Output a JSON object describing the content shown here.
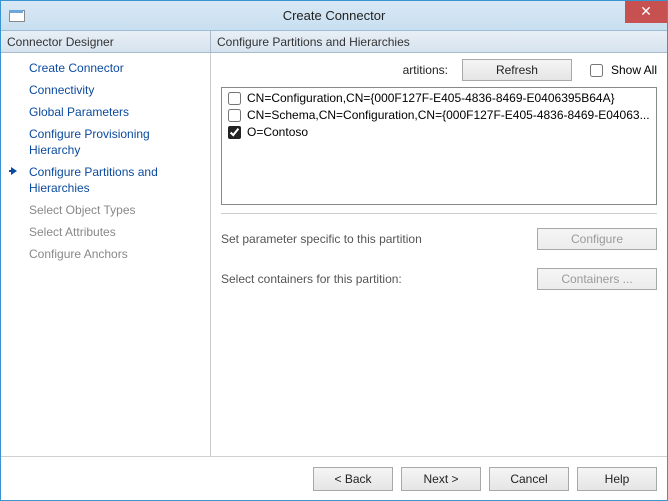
{
  "window": {
    "title": "Create Connector"
  },
  "header": {
    "left_label": "Connector Designer",
    "right_label": "Configure Partitions and Hierarchies"
  },
  "sidebar": {
    "items": [
      {
        "label": "Create Connector",
        "disabled": false
      },
      {
        "label": "Connectivity",
        "disabled": false
      },
      {
        "label": "Global Parameters",
        "disabled": false
      },
      {
        "label": "Configure Provisioning Hierarchy",
        "disabled": false
      },
      {
        "label": "Configure Partitions and Hierarchies",
        "disabled": false,
        "active": true
      },
      {
        "label": "Select Object Types",
        "disabled": true
      },
      {
        "label": "Select Attributes",
        "disabled": true
      },
      {
        "label": "Configure Anchors",
        "disabled": true
      }
    ]
  },
  "toolbar": {
    "partitions_label": "artitions:",
    "refresh_label": "Refresh",
    "showall_label": "Show All",
    "showall_checked": false
  },
  "partitions": [
    {
      "label": "CN=Configuration,CN={000F127F-E405-4836-8469-E0406395B64A}",
      "checked": false
    },
    {
      "label": "CN=Schema,CN=Configuration,CN={000F127F-E405-4836-8469-E04063...",
      "checked": false
    },
    {
      "label": "O=Contoso",
      "checked": true
    }
  ],
  "params": {
    "row1_label": "Set parameter specific to this partition",
    "row1_button": "Configure",
    "row2_label": "Select containers for this partition:",
    "row2_button": "Containers ..."
  },
  "footer": {
    "back": "<  Back",
    "next": "Next  >",
    "cancel": "Cancel",
    "help": "Help"
  }
}
